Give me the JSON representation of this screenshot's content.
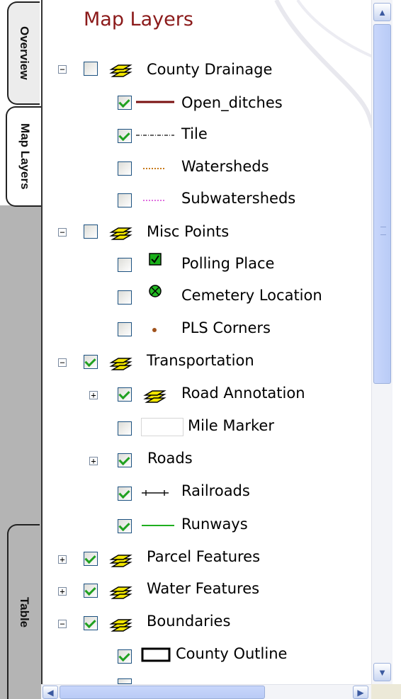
{
  "tabs": {
    "overview": "Overview",
    "map_layers": "Map Layers",
    "table": "Table"
  },
  "panel": {
    "title": "Map Layers"
  },
  "colors": {
    "title": "#8b1a1a",
    "check": "#21a121",
    "layer_icon": "#f2e600"
  },
  "layers": [
    {
      "label": "County Drainage",
      "checked": false,
      "expander": "minus",
      "symbol": "layer-stack-icon"
    },
    {
      "label": "Open_ditches",
      "checked": true,
      "symbol": "solid-dark-red-line"
    },
    {
      "label": "Tile",
      "checked": true,
      "symbol": "dash-dot-line"
    },
    {
      "label": "Watersheds",
      "checked": false,
      "symbol": "dotted-orange-line"
    },
    {
      "label": "Subwatersheds",
      "checked": false,
      "symbol": "dotted-pink-line"
    },
    {
      "label": "Misc Points",
      "checked": false,
      "expander": "minus",
      "symbol": "layer-stack-icon"
    },
    {
      "label": "Polling Place",
      "checked": false,
      "symbol": "green-check-box-icon"
    },
    {
      "label": "Cemetery Location",
      "checked": false,
      "symbol": "green-cross-circle-icon"
    },
    {
      "label": "PLS Corners",
      "checked": false,
      "symbol": "brown-dot-icon"
    },
    {
      "label": "Transportation",
      "checked": true,
      "expander": "minus",
      "symbol": "layer-stack-icon"
    },
    {
      "label": "Road Annotation",
      "checked": true,
      "expander": "plus",
      "symbol": "layer-stack-icon"
    },
    {
      "label": "Mile Marker",
      "checked": false,
      "symbol": "blank-box"
    },
    {
      "label": "Roads",
      "checked": true,
      "expander": "plus"
    },
    {
      "label": "Railroads",
      "checked": true,
      "symbol": "railroad-line"
    },
    {
      "label": "Runways",
      "checked": true,
      "symbol": "solid-green-line"
    },
    {
      "label": "Parcel Features",
      "checked": true,
      "expander": "plus",
      "symbol": "layer-stack-icon"
    },
    {
      "label": "Water Features",
      "checked": true,
      "expander": "plus",
      "symbol": "layer-stack-icon"
    },
    {
      "label": "Boundaries",
      "checked": true,
      "expander": "minus",
      "symbol": "layer-stack-icon"
    },
    {
      "label": "County Outline",
      "checked": true,
      "symbol": "outline-rectangle-icon"
    }
  ]
}
